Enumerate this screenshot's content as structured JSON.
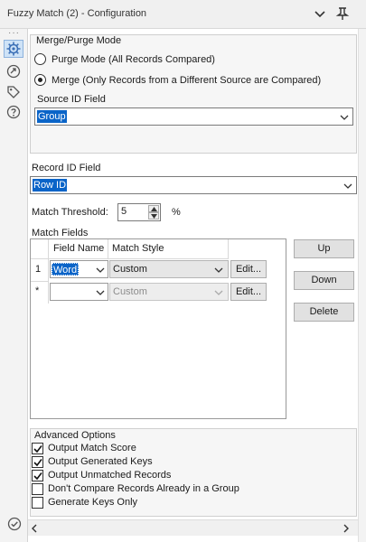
{
  "title": "Fuzzy Match (2) - Configuration",
  "merge_purge": {
    "section_label": "Merge/Purge Mode",
    "option_purge": "Purge Mode (All Records Compared)",
    "option_merge": "Merge (Only Records from a Different Source are Compared)",
    "selected": "merge",
    "source_id_label": "Source ID Field",
    "source_id_value": "Group"
  },
  "record_id": {
    "label": "Record ID Field",
    "value": "Row ID"
  },
  "threshold": {
    "label": "Match Threshold:",
    "value": "5",
    "unit": "%"
  },
  "match_fields": {
    "label": "Match Fields",
    "columns": [
      "Field Name",
      "Match Style"
    ],
    "rows": [
      {
        "marker": "1",
        "field": "Word",
        "style": "Custom",
        "edit": "Edit..."
      },
      {
        "marker": "*",
        "field": "",
        "style": "Custom",
        "edit": "Edit..."
      }
    ],
    "buttons": {
      "up": "Up",
      "down": "Down",
      "delete": "Delete"
    }
  },
  "advanced": {
    "label": "Advanced Options",
    "options": [
      {
        "label": "Output Match Score",
        "checked": true
      },
      {
        "label": "Output Generated Keys",
        "checked": true
      },
      {
        "label": "Output Unmatched Records",
        "checked": true
      },
      {
        "label": "Don't Compare Records Already in a Group",
        "checked": false
      },
      {
        "label": "Generate Keys Only",
        "checked": false
      }
    ]
  },
  "colors": {
    "selection": "#0a64c8",
    "active_tool": "#cfe3f7"
  },
  "icons": {
    "sidebar": [
      "dots-icon",
      "gear-icon",
      "connection-icon",
      "tag-icon",
      "help-icon",
      "check-circle-icon"
    ],
    "titlebar": [
      "chevron-down-icon",
      "pin-icon"
    ]
  }
}
